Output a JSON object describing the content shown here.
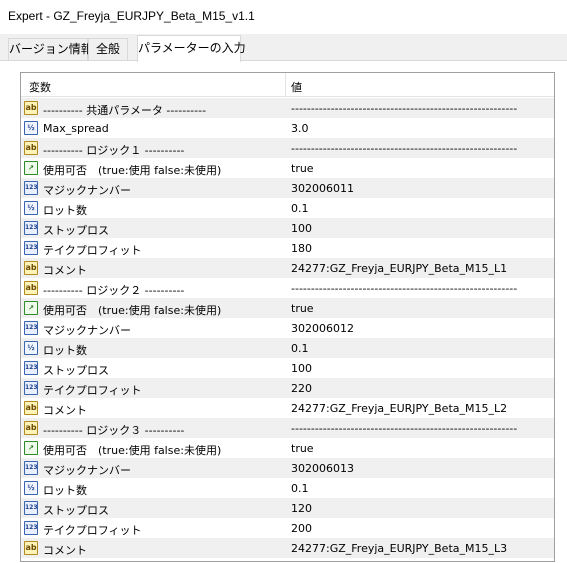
{
  "window": {
    "title": "Expert - GZ_Freyja_EURJPY_Beta_M15_v1.1"
  },
  "tabs": [
    {
      "label": "バージョン情報",
      "active": false
    },
    {
      "label": "全般",
      "active": false
    },
    {
      "label": "パラメーターの入力",
      "active": true
    }
  ],
  "table": {
    "headers": {
      "variable": "変数",
      "value": "値"
    },
    "rows": [
      {
        "icon": "ab",
        "name": "----------    共通パラメータ    ----------",
        "value": "---------------------------------------------------------"
      },
      {
        "icon": "v2",
        "name": "Max_spread",
        "value": "3.0"
      },
      {
        "icon": "ab",
        "name": "----------    ロジック１    ----------",
        "value": "---------------------------------------------------------"
      },
      {
        "icon": "bool",
        "name": "使用可否　(true:使用  false:未使用)",
        "value": "true"
      },
      {
        "icon": "123",
        "name": "マジックナンバー",
        "value": "302006011"
      },
      {
        "icon": "v2",
        "name": "ロット数",
        "value": "0.1"
      },
      {
        "icon": "123",
        "name": "ストップロス",
        "value": "100"
      },
      {
        "icon": "123",
        "name": "テイクプロフィット",
        "value": "180"
      },
      {
        "icon": "ab",
        "name": "コメント",
        "value": "24277:GZ_Freyja_EURJPY_Beta_M15_L1"
      },
      {
        "icon": "ab",
        "name": "----------    ロジック２    ----------",
        "value": "---------------------------------------------------------"
      },
      {
        "icon": "bool",
        "name": "使用可否　(true:使用  false:未使用)",
        "value": "true"
      },
      {
        "icon": "123",
        "name": "マジックナンバー",
        "value": "302006012"
      },
      {
        "icon": "v2",
        "name": "ロット数",
        "value": "0.1"
      },
      {
        "icon": "123",
        "name": "ストップロス",
        "value": "100"
      },
      {
        "icon": "123",
        "name": "テイクプロフィット",
        "value": "220"
      },
      {
        "icon": "ab",
        "name": "コメント",
        "value": "24277:GZ_Freyja_EURJPY_Beta_M15_L2"
      },
      {
        "icon": "ab",
        "name": "----------    ロジック３    ----------",
        "value": "---------------------------------------------------------"
      },
      {
        "icon": "bool",
        "name": "使用可否　(true:使用  false:未使用)",
        "value": "true"
      },
      {
        "icon": "123",
        "name": "マジックナンバー",
        "value": "302006013"
      },
      {
        "icon": "v2",
        "name": "ロット数",
        "value": "0.1"
      },
      {
        "icon": "123",
        "name": "ストップロス",
        "value": "120"
      },
      {
        "icon": "123",
        "name": "テイクプロフィット",
        "value": "200"
      },
      {
        "icon": "ab",
        "name": "コメント",
        "value": "24277:GZ_Freyja_EURJPY_Beta_M15_L3"
      }
    ]
  },
  "icons": {
    "ab": {
      "text": "ab",
      "name": "string-type-icon"
    },
    "v2": {
      "text": "½",
      "name": "double-type-icon"
    },
    "123": {
      "text": "123",
      "name": "integer-type-icon"
    },
    "bool": {
      "text": "↗",
      "name": "bool-type-icon"
    }
  },
  "colors": {
    "alt_row": "#f0f0f0",
    "border": "#a0a0a0"
  }
}
